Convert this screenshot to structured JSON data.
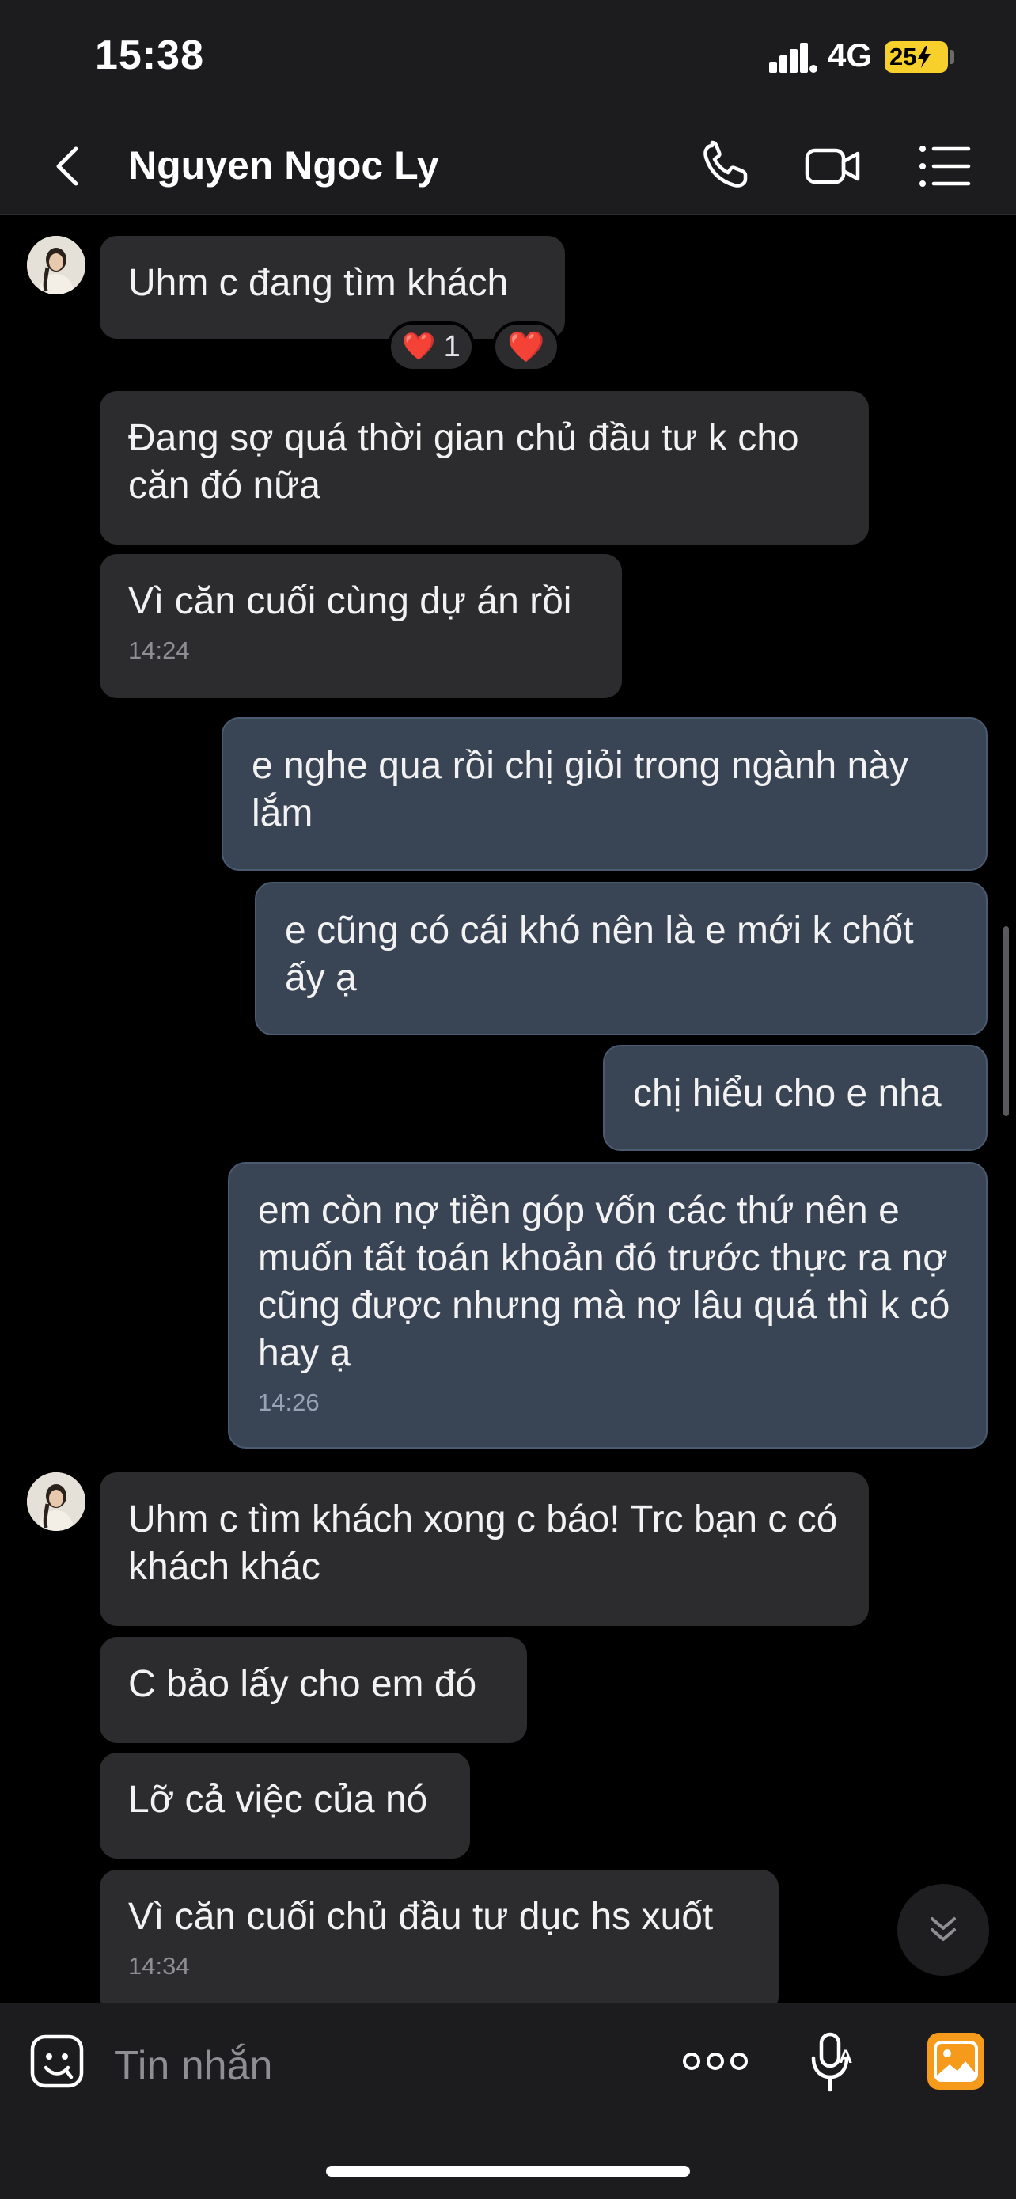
{
  "status_bar": {
    "time": "15:38",
    "network": "4G",
    "battery": "25"
  },
  "header": {
    "contact_name": "Nguyen Ngoc Ly"
  },
  "messages": [
    {
      "from": "contact",
      "text": "Uhm c đang tìm khách",
      "reactions": [
        {
          "emoji": "❤️",
          "count": "1"
        },
        {
          "emoji": "❤️"
        }
      ]
    },
    {
      "from": "contact",
      "text": "Đang sợ quá thời gian chủ đầu tư k cho căn đó nữa"
    },
    {
      "from": "contact",
      "text": "Vì căn cuối cùng dự án rồi",
      "time": "14:24"
    },
    {
      "from": "me",
      "text": "e nghe qua rồi chị giỏi trong ngành này lắm"
    },
    {
      "from": "me",
      "text": "e cũng có cái khó nên là e mới k chốt ấy ạ"
    },
    {
      "from": "me",
      "text": "chị hiểu cho e nha"
    },
    {
      "from": "me",
      "text": "em còn nợ tiền góp vốn các thứ nên e muốn tất toán khoản đó trước thực ra nợ cũng được nhưng mà nợ lâu quá thì k có hay ạ",
      "time": "14:26"
    },
    {
      "from": "contact",
      "text": "Uhm c tìm khách xong c báo! Trc bạn c có khách khác"
    },
    {
      "from": "contact",
      "text": "C bảo lấy cho em đó"
    },
    {
      "from": "contact",
      "text": "Lỡ cả việc của nó"
    },
    {
      "from": "contact",
      "text": "Vì căn cuối chủ đầu tư dục hs xuốt",
      "time": "14:34"
    }
  ],
  "composer": {
    "placeholder": "Tin nhắn"
  },
  "icons": {
    "back": "chevron-left-icon",
    "call": "phone-icon",
    "video": "video-camera-icon",
    "menu": "list-menu-icon",
    "sticker": "sticker-face-icon",
    "more": "more-dots-icon",
    "voice": "microphone-icon",
    "image": "image-gallery-icon",
    "scroll_down": "double-chevron-down-icon"
  },
  "colors": {
    "background": "#000000",
    "incoming_bubble": "#2c2c2e",
    "outgoing_bubble": "#394454",
    "image_button": "#f59a1b",
    "battery": "#f7d02c"
  }
}
